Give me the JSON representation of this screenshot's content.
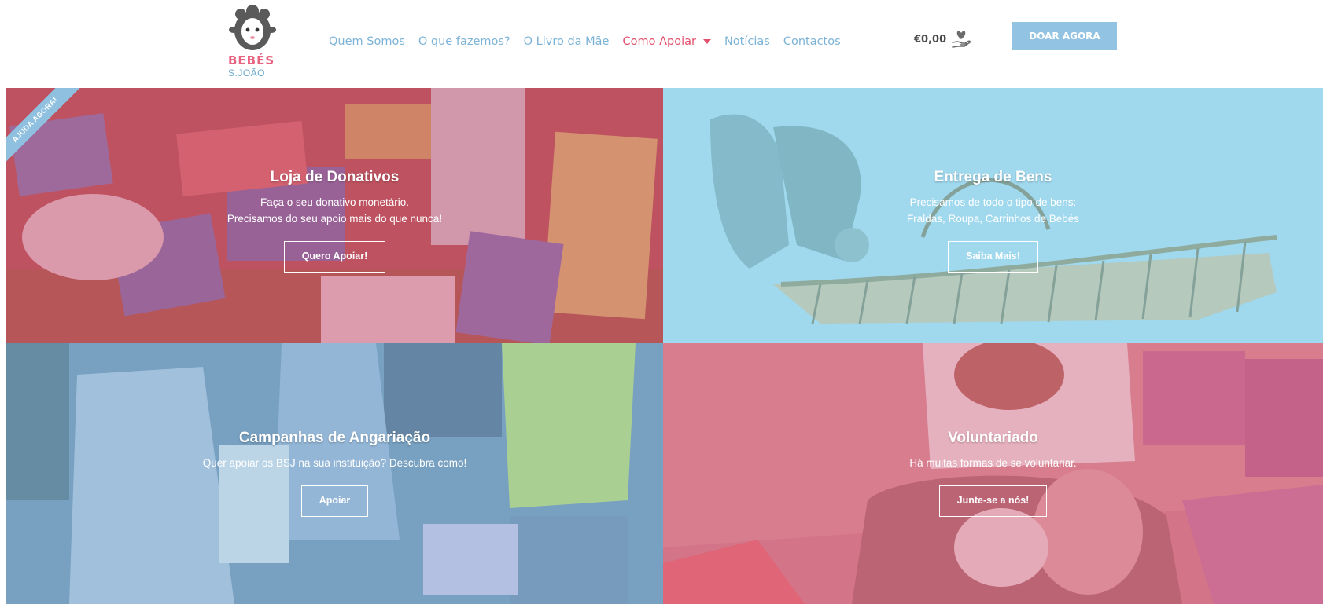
{
  "logo": {
    "title": "BEBÉS",
    "subtitle": "S.JOÃO"
  },
  "nav": {
    "items": [
      {
        "label": "Quem Somos"
      },
      {
        "label": "O que fazemos?"
      },
      {
        "label": "O Livro da Mãe"
      },
      {
        "label": "Como Apoiar"
      },
      {
        "label": "Notícias"
      },
      {
        "label": "Contactos"
      }
    ],
    "active": "Como Apoiar"
  },
  "cart": {
    "amount": "€0,00"
  },
  "donate_button": "DOAR AGORA",
  "tiles": [
    {
      "ribbon": "AJUDA AGORA!",
      "title": "Loja de Donativos",
      "line1": "Faça o seu donativo monetário.",
      "line2": "Precisamos do seu apoio mais do que nunca!",
      "button": "Quero Apoiar!",
      "overlay_color": "#c85a72"
    },
    {
      "title": "Entrega de Bens",
      "line1": "Precisamos de todo o tipo de bens:",
      "line2": "Fraldas, Roupa, Carrinhos de Bebés",
      "button": "Saiba Mais!",
      "overlay_color": "#8ecde8"
    },
    {
      "title": "Campanhas de Angariação",
      "line1": "Quer apoiar os BSJ na sua instituição? Descubra como!",
      "button": "Apoiar",
      "overlay_color": "#86b6d6"
    },
    {
      "title": "Voluntariado",
      "line1": "Há muitas formas de se voluntariar.",
      "button": "Junte-se a nós!",
      "overlay_color": "#d86c84"
    }
  ],
  "colors": {
    "brand_pink": "#e24f6b",
    "brand_blue": "#7cb3d6",
    "button_blue": "#93c3e2"
  },
  "icons": {
    "logo": "sheep-mascot-icon",
    "cart": "hand-heart-icon",
    "dropdown": "caret-down-icon"
  }
}
